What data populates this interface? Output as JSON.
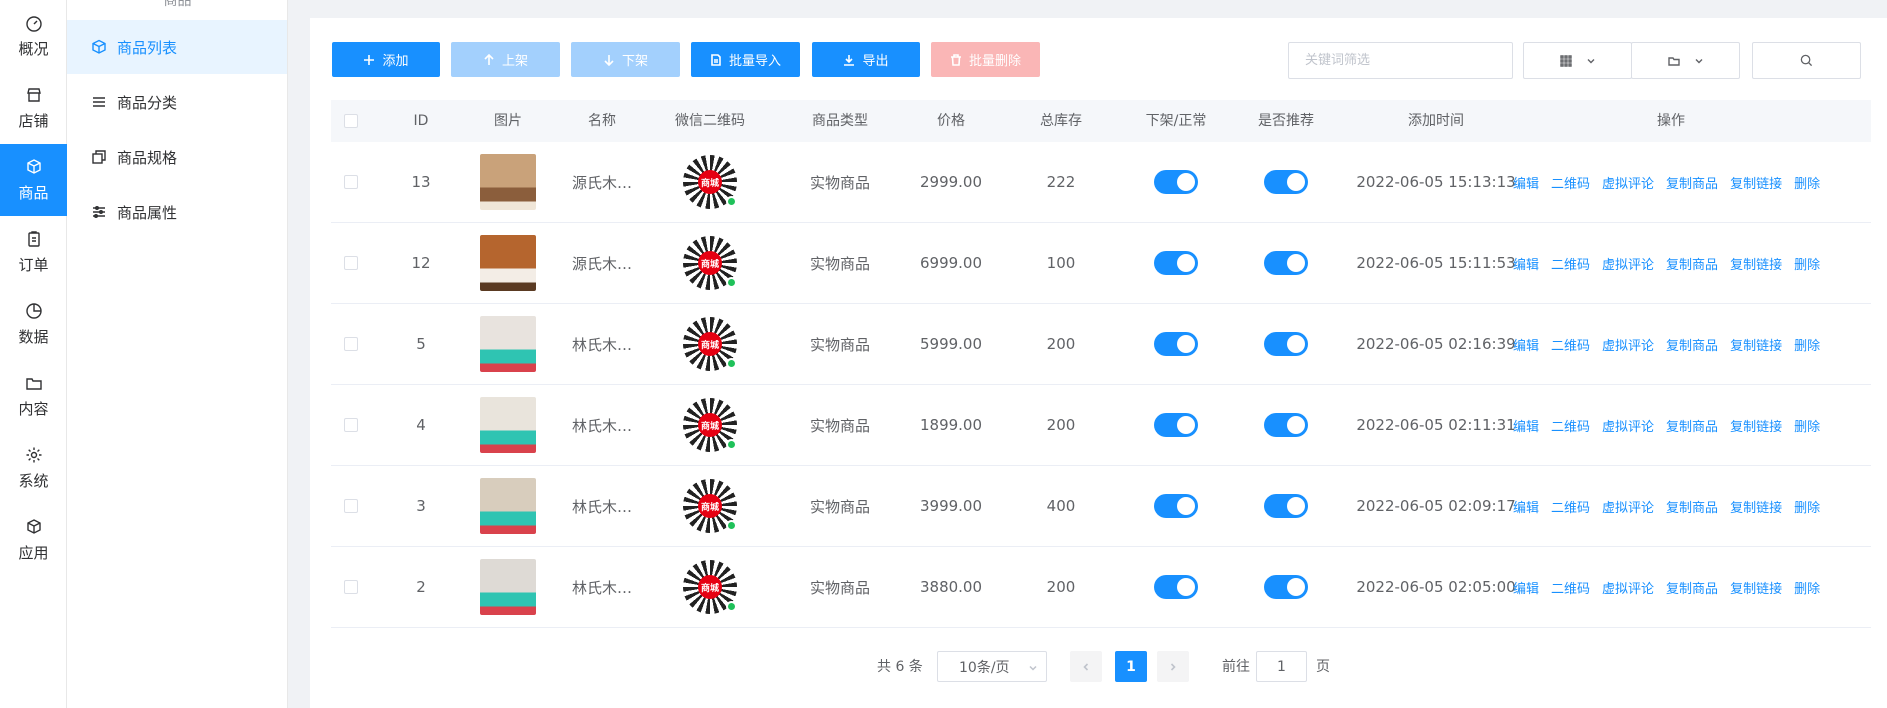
{
  "nav": {
    "items": [
      {
        "label": "概况",
        "icon": "dashboard-icon"
      },
      {
        "label": "店铺",
        "icon": "store-icon"
      },
      {
        "label": "商品",
        "icon": "cube-icon"
      },
      {
        "label": "订单",
        "icon": "clipboard-icon"
      },
      {
        "label": "数据",
        "icon": "pie-chart-icon"
      },
      {
        "label": "内容",
        "icon": "folder-icon"
      },
      {
        "label": "系统",
        "icon": "gear-icon"
      },
      {
        "label": "应用",
        "icon": "app-cube-icon"
      }
    ]
  },
  "submenu": {
    "header": "商品",
    "items": [
      {
        "label": "商品列表",
        "icon": "cube-icon"
      },
      {
        "label": "商品分类",
        "icon": "list-icon"
      },
      {
        "label": "商品规格",
        "icon": "copy-icon"
      },
      {
        "label": "商品属性",
        "icon": "sliders-icon"
      }
    ]
  },
  "toolbar": {
    "add": "添加",
    "on_shelf": "上架",
    "off_shelf": "下架",
    "batch_import": "批量导入",
    "export": "导出",
    "batch_delete": "批量删除"
  },
  "search": {
    "placeholder": "关键词筛选"
  },
  "table": {
    "headers": [
      "ID",
      "图片",
      "名称",
      "微信二维码",
      "商品类型",
      "价格",
      "总库存",
      "下架/正常",
      "是否推荐",
      "添加时间",
      "操作"
    ],
    "qr_badge": "商城",
    "rows": [
      {
        "id": "13",
        "name": "源氏木…",
        "type": "实物商品",
        "price": "2999.00",
        "stock": "222",
        "time": "2022-06-05 15:13:13"
      },
      {
        "id": "12",
        "name": "源氏木…",
        "type": "实物商品",
        "price": "6999.00",
        "stock": "100",
        "time": "2022-06-05 15:11:53"
      },
      {
        "id": "5",
        "name": "林氏木…",
        "type": "实物商品",
        "price": "5999.00",
        "stock": "200",
        "time": "2022-06-05 02:16:39"
      },
      {
        "id": "4",
        "name": "林氏木…",
        "type": "实物商品",
        "price": "1899.00",
        "stock": "200",
        "time": "2022-06-05 02:11:31"
      },
      {
        "id": "3",
        "name": "林氏木…",
        "type": "实物商品",
        "price": "3999.00",
        "stock": "400",
        "time": "2022-06-05 02:09:17"
      },
      {
        "id": "2",
        "name": "林氏木…",
        "type": "实物商品",
        "price": "3880.00",
        "stock": "200",
        "time": "2022-06-05 02:05:00"
      }
    ],
    "actions": [
      "编辑",
      "二维码",
      "虚拟评论",
      "复制商品",
      "复制链接",
      "删除"
    ]
  },
  "pagination": {
    "total": "共 6 条",
    "page_size": "10条/页",
    "current_page": "1",
    "goto_label": "前往",
    "goto_value": "1",
    "page_unit": "页"
  },
  "colors": {
    "primary": "#1890ff",
    "primary_disabled": "#a3d0fd",
    "danger_disabled": "#fab6b6",
    "qr_badge": "#e60012"
  }
}
